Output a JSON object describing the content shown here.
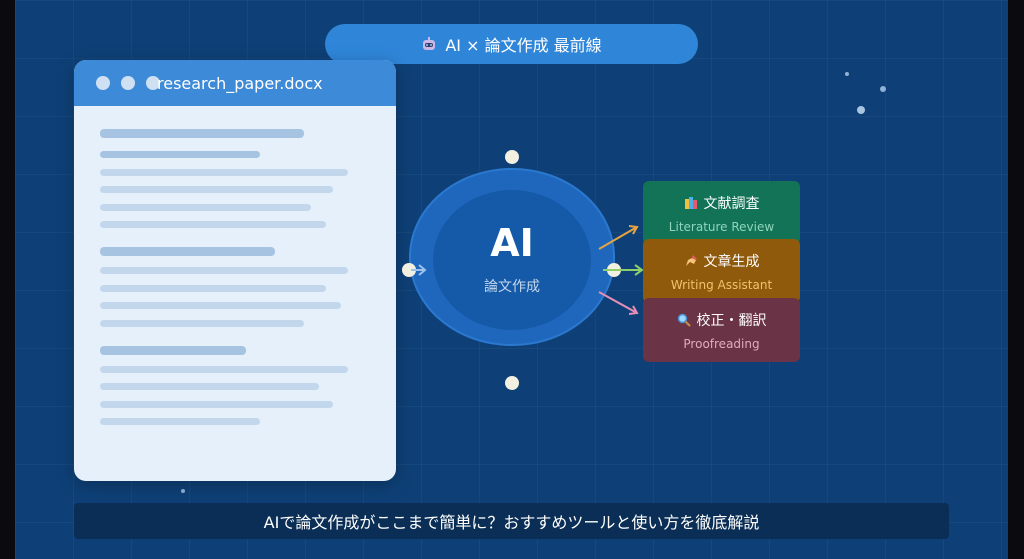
{
  "header": {
    "title": "AI × 論文作成 最前線",
    "icon": "robot-icon"
  },
  "document": {
    "filename": "research_paper.docx"
  },
  "hub": {
    "main": "AI",
    "sub": "論文作成"
  },
  "cards": [
    {
      "title": "文献調査",
      "subtitle": "Literature Review",
      "icon": "books-icon",
      "color": "#127356"
    },
    {
      "title": "文章生成",
      "subtitle": "Writing Assistant",
      "icon": "writing-hand-icon",
      "color": "#8f5a0c"
    },
    {
      "title": "校正・翻訳",
      "subtitle": "Proofreading",
      "icon": "magnifier-icon",
      "color": "#6a3446"
    }
  ],
  "caption": "AIで論文作成がここまで簡単に？おすすめツールと使い方を徹底解説"
}
